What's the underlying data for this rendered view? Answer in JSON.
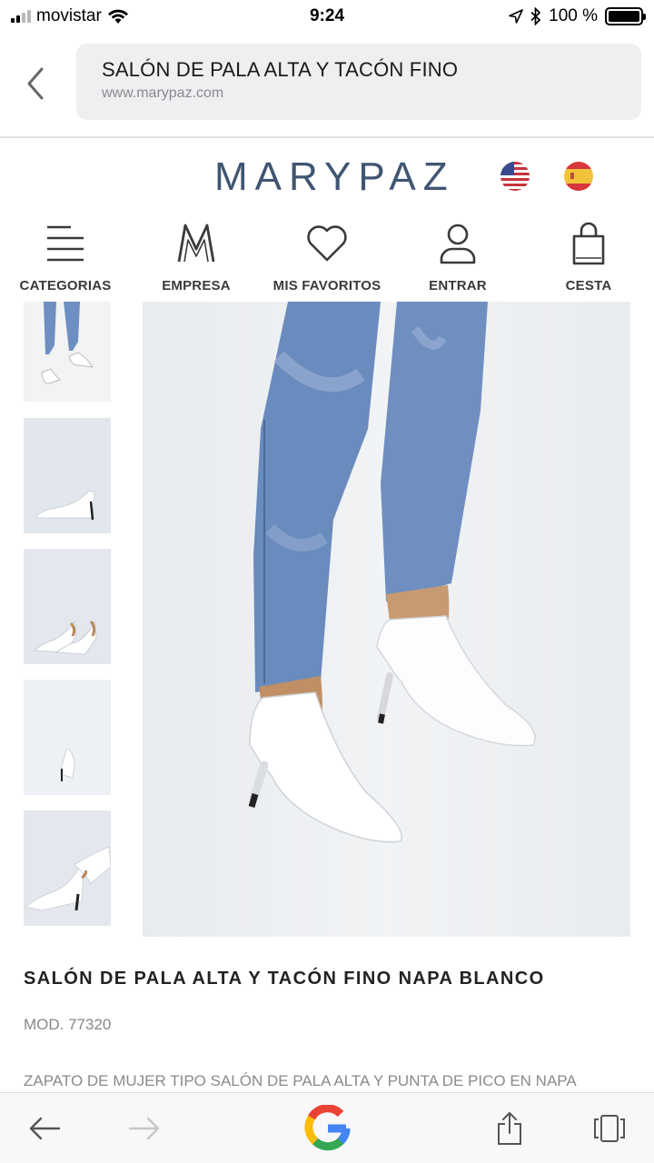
{
  "status": {
    "carrier": "movistar",
    "time": "9:24",
    "battery": "100 %",
    "signal_bars": 4,
    "signal_bars_active": 2
  },
  "browser": {
    "page_title": "SALÓN DE PALA ALTA Y TACÓN FINO",
    "domain": "www.marypaz.com"
  },
  "site": {
    "logo": "MARYPAZ",
    "languages": [
      "en-us-flag-icon",
      "es-flag-icon"
    ],
    "nav": [
      {
        "label": "CATEGORIAS",
        "icon": "menu-lines-icon"
      },
      {
        "label": "EMPRESA",
        "icon": "m-logo-icon"
      },
      {
        "label": "MIS FAVORITOS",
        "icon": "heart-icon"
      },
      {
        "label": "ENTRAR",
        "icon": "user-icon"
      },
      {
        "label": "CESTA",
        "icon": "shopping-bag-icon"
      }
    ]
  },
  "product": {
    "title": "SALÓN DE PALA ALTA Y TACÓN FINO NAPA BLANCO",
    "model": "MOD. 77320",
    "description": "ZAPATO DE MUJER TIPO SALÓN DE PALA ALTA Y PUNTA DE PICO EN NAPA"
  },
  "colors": {
    "brand": "#405573",
    "url_bar": "#efeff1",
    "shoe": "#ffffff",
    "denim": "#6d8fc1"
  }
}
